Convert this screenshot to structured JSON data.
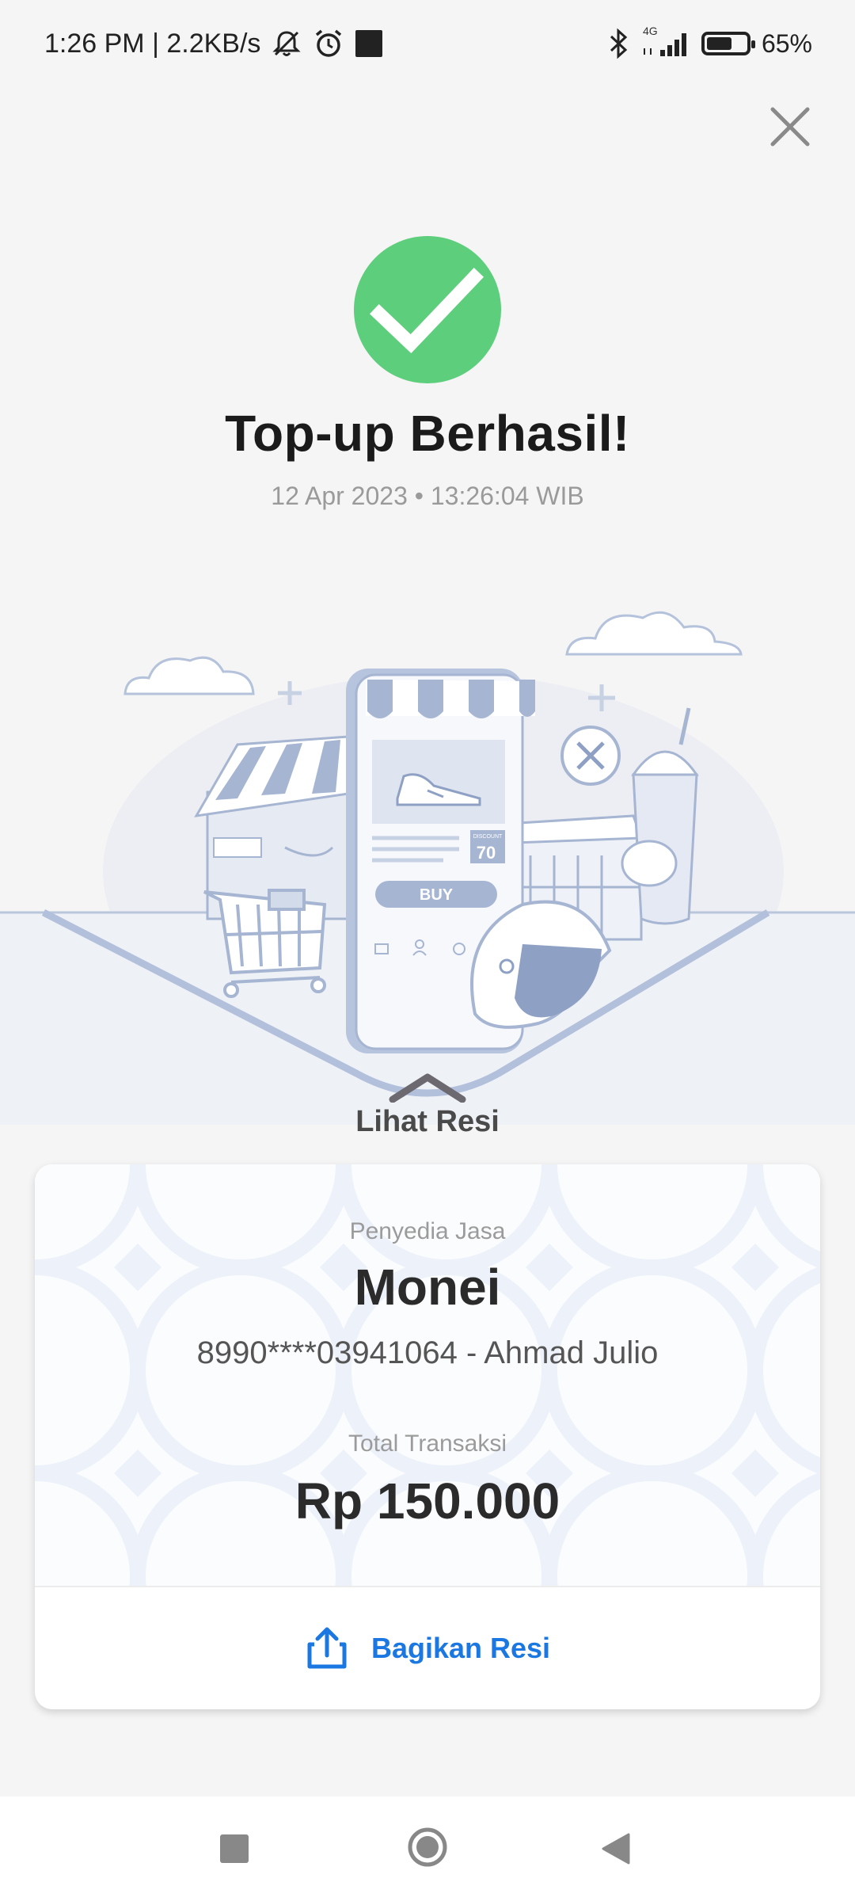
{
  "status_bar": {
    "time_speed": "1:26 PM | 2.2KB/s",
    "network": "4G",
    "battery_percent": "65%",
    "battery_level": 0.65
  },
  "success": {
    "title": "Top-up Berhasil!",
    "timestamp": "12 Apr 2023 • 13:26:04 WIB",
    "accent_color": "#5dce7c"
  },
  "illustration": {
    "buy_label": "BUY",
    "discount_label": "DISCOUNT",
    "discount_value": "70"
  },
  "receipt": {
    "toggle_label": "Lihat Resi",
    "provider_label": "Penyedia Jasa",
    "provider_name": "Monei",
    "account_line": "8990****03941064 - Ahmad Julio",
    "total_label": "Total Transaksi",
    "total_value": "Rp 150.000",
    "share_label": "Bagikan Resi",
    "share_color": "#1b78e2"
  },
  "icons": {
    "close": "close-icon",
    "check": "check-icon",
    "share": "share-icon",
    "bell_off": "bell-off-icon",
    "alarm": "alarm-icon",
    "bluetooth": "bluetooth-icon",
    "signal": "signal-icon",
    "battery": "battery-icon",
    "nav_recent": "recent-apps-icon",
    "nav_home": "home-icon",
    "nav_back": "back-icon"
  }
}
